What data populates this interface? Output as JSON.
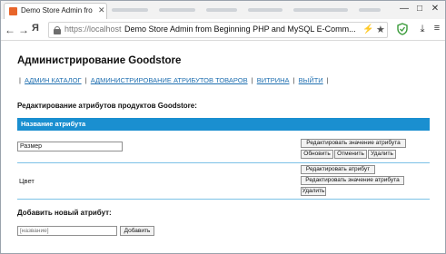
{
  "browser": {
    "tab_title": "Demo Store Admin fro",
    "url": "https://localhost",
    "address_title": "Demo Store Admin from Beginning PHP and MySQL E-Comm...",
    "yandex_label": "Я",
    "icons": {
      "back": "arrow-left-icon",
      "forward": "arrow-right-icon",
      "lock": "lock-icon",
      "bolt": "lightning-icon",
      "star": "star-icon",
      "shield": "shield-icon",
      "download": "download-icon",
      "menu": "menu-icon"
    },
    "window_controls": [
      "—",
      "□",
      "✕"
    ]
  },
  "page": {
    "heading": "Администрирование Goodstore",
    "nav": {
      "items": [
        "АДМИН КАТАЛОГ",
        "АДМИНИСТРИРОВАНИЕ АТРИБУТОВ ТОВАРОВ",
        "ВИТРИНА",
        "ВЫЙТИ"
      ]
    },
    "section_title": "Редактирование атрибутов продуктов Goodstore:",
    "table": {
      "header": "Название атрибута",
      "header_color": "#1a8fd0",
      "rows": [
        {
          "name_value": "Размер",
          "buttons": [
            "Редактировать значение атрибута",
            "Обновить",
            "Отменить",
            "Удалить"
          ]
        },
        {
          "name_label": "Цвет",
          "buttons": [
            "Редактировать атрибут",
            "Редактировать значение атрибута",
            "Удалить"
          ]
        }
      ]
    },
    "add": {
      "title": "Добавить новый атрибут:",
      "placeholder": "[название]",
      "button": "Добавить"
    }
  }
}
